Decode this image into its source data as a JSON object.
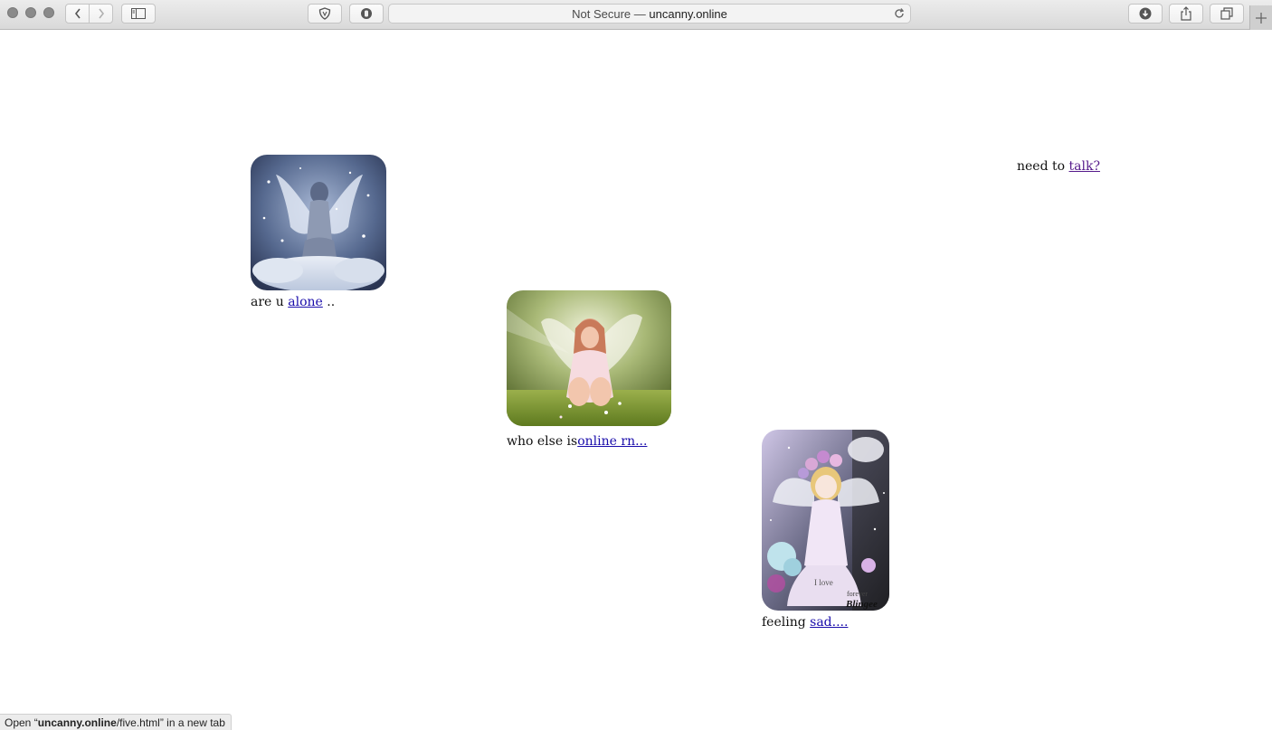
{
  "browser": {
    "address": {
      "prefix": "Not Secure — ",
      "host": "uncanny.online"
    },
    "status_bar": {
      "open_prefix": "Open “",
      "host": "uncanny.online",
      "path": "/five.html",
      "suffix": "” in a new tab"
    }
  },
  "page": {
    "top_right": {
      "text": "need to ",
      "link": "talk?"
    },
    "items": [
      {
        "image": "angel-winged-woman-on-clouds",
        "before": "are u ",
        "link": "alone",
        "after": " .."
      },
      {
        "image": "child-fairy-in-meadow",
        "before": "who else is",
        "link": "online rn...",
        "after": ""
      },
      {
        "image": "anime-fairy-blingee-glitter",
        "before": "feeling ",
        "link": "sad....",
        "after": ""
      }
    ],
    "blingee_stamp": "Blingee",
    "love_text": "I love",
    "forever_text": "forever"
  }
}
